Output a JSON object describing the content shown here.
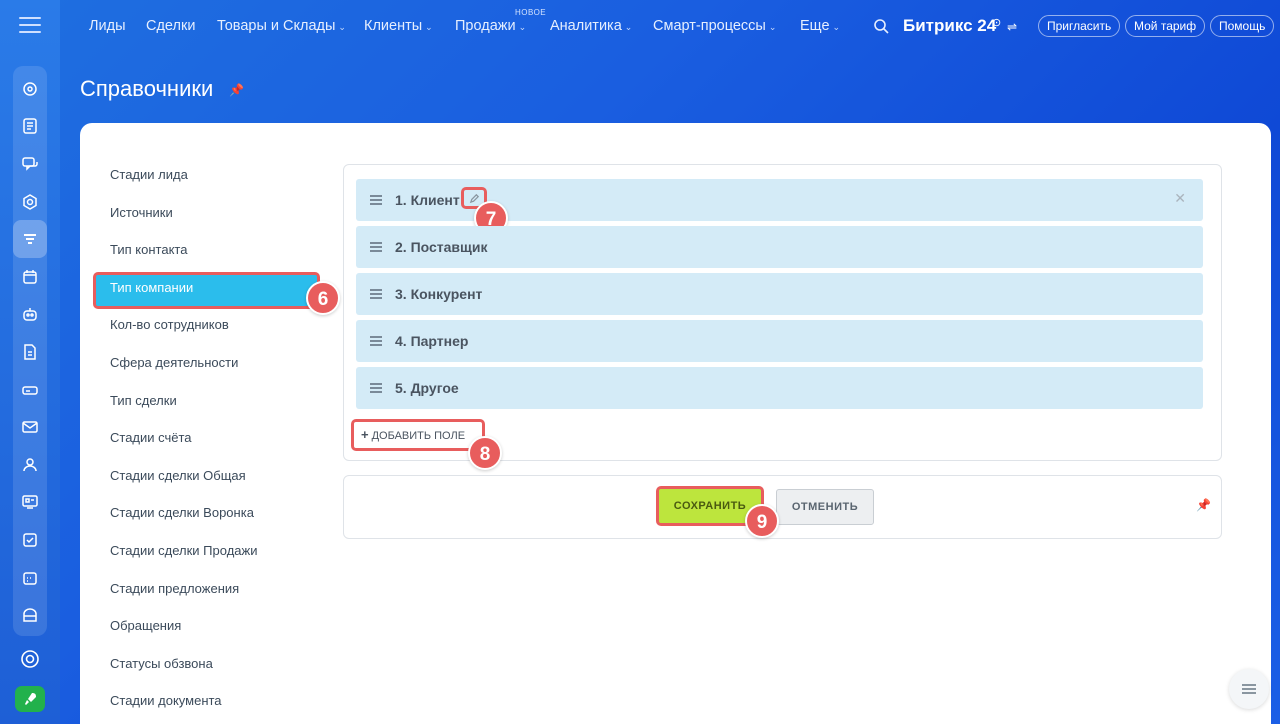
{
  "topbar": {
    "nav": [
      {
        "label": "Лиды",
        "chevron": false
      },
      {
        "label": "Сделки",
        "chevron": false
      },
      {
        "label": "Товары и Склады",
        "chevron": true
      },
      {
        "label": "Клиенты",
        "chevron": true
      },
      {
        "label": "Продажи",
        "chevron": true
      },
      {
        "label": "Аналитика",
        "chevron": true
      },
      {
        "label": "Смарт-процессы",
        "chevron": true
      },
      {
        "label": "Еще",
        "chevron": true
      }
    ],
    "new_badge": "НОВОЕ",
    "brand": "Битрикс 24",
    "buttons": {
      "invite": "Пригласить",
      "tariff": "Мой тариф",
      "help": "Помощь"
    }
  },
  "page": {
    "title": "Справочники"
  },
  "left_list": [
    "Стадии лида",
    "Источники",
    "Тип контакта",
    "Тип компании",
    "Кол-во сотрудников",
    "Сфера деятельности",
    "Тип сделки",
    "Стадии счёта",
    "Стадии сделки Общая",
    "Стадии сделки Воронка",
    "Стадии сделки Продажи",
    "Стадии предложения",
    "Обращения",
    "Статусы обзвона",
    "Стадии документа"
  ],
  "active_left_item": "Тип компании",
  "rows": [
    "1. Клиент",
    "2. Поставщик",
    "3. Конкурент",
    "4. Партнер",
    "5. Другое"
  ],
  "add_field": "ДОБАВИТЬ ПОЛЕ",
  "actions": {
    "save": "СОХРАНИТЬ",
    "cancel": "ОТМЕНИТЬ"
  },
  "badges": {
    "b6": "6",
    "b7": "7",
    "b8": "8",
    "b9": "9"
  },
  "colors": {
    "accent_red": "#e85d5d",
    "save_green": "#bde53d",
    "active_blue": "#2bbdec",
    "row_bg": "#d4ebf7"
  }
}
